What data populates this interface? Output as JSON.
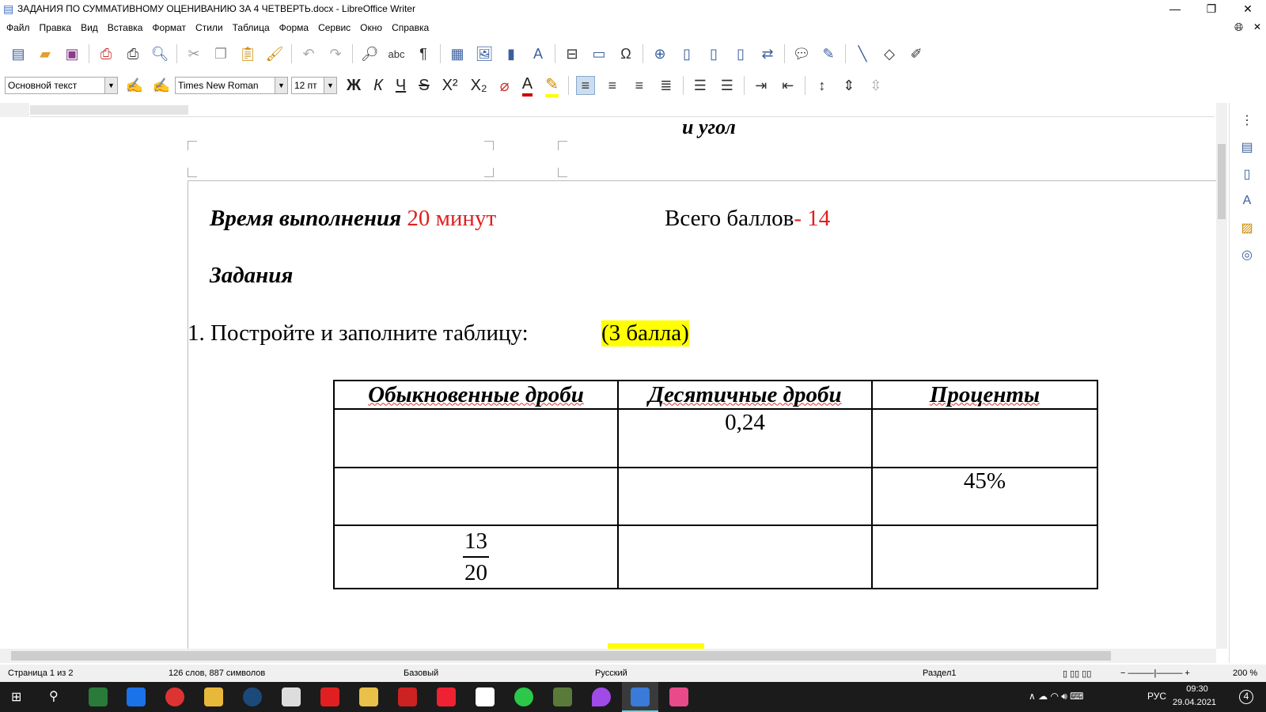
{
  "window": {
    "title": "ЗАДАНИЯ ПО СУММАТИВНОМУ ОЦЕНИВАНИЮ ЗА 4 ЧЕТВЕРТЬ.docx - LibreOffice Writer"
  },
  "menu": [
    "Файл",
    "Правка",
    "Вид",
    "Вставка",
    "Формат",
    "Стили",
    "Таблица",
    "Форма",
    "Сервис",
    "Окно",
    "Справка"
  ],
  "formatting": {
    "style": "Основной текст",
    "font": "Times New Roman",
    "size": "12 пт",
    "bold": "Ж",
    "italic": "К",
    "underline": "Ч",
    "strike": "S",
    "superscript": "X²",
    "subscript": "X₂",
    "font_color": "A"
  },
  "document": {
    "heading_tail": "и угол",
    "time_label": "Время выполнения",
    "time_value": "20 минут",
    "points_label": "Всего баллов",
    "points_value": "- 14",
    "tasks_heading": "Задания",
    "task1": "1. Постройте и заполните таблицу:",
    "task1_points": "(3 балла)",
    "table": {
      "headers": [
        "Обыкновенные дроби",
        "Десятичные дроби",
        "Проценты"
      ],
      "rows": [
        [
          "",
          "0,24",
          ""
        ],
        [
          "",
          "",
          "45%"
        ],
        [
          {
            "num": "13",
            "den": "20"
          },
          "",
          ""
        ]
      ]
    }
  },
  "status": {
    "page": "Страница 1 из 2",
    "words": "126 слов, 887 символов",
    "style": "Базовый",
    "lang": "Русский",
    "section": "Раздел1",
    "zoom": "200 %"
  },
  "taskbar": {
    "lang": "РУС",
    "time": "09:30",
    "date": "29.04.2021",
    "notifications": "4"
  },
  "colors": {
    "accent": "#e02020",
    "highlight": "#ffff00"
  }
}
